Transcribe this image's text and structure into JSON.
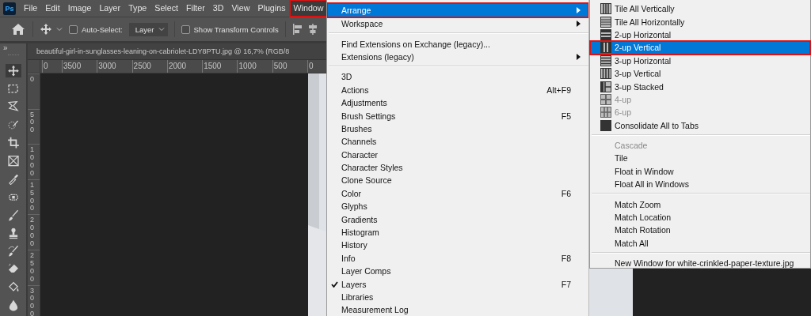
{
  "app_logo": "Ps",
  "menu_bar": [
    {
      "label": "File",
      "selected": false
    },
    {
      "label": "Edit",
      "selected": false
    },
    {
      "label": "Image",
      "selected": false
    },
    {
      "label": "Layer",
      "selected": false
    },
    {
      "label": "Type",
      "selected": false
    },
    {
      "label": "Select",
      "selected": false
    },
    {
      "label": "Filter",
      "selected": false
    },
    {
      "label": "3D",
      "selected": false
    },
    {
      "label": "View",
      "selected": false
    },
    {
      "label": "Plugins",
      "selected": false
    },
    {
      "label": "Window",
      "selected": true
    }
  ],
  "options_bar": {
    "auto_select": {
      "label": "Auto-Select:",
      "checked": false
    },
    "layer_dropdown": "Layer",
    "show_transform": {
      "label": "Show Transform Controls",
      "checked": false
    }
  },
  "toolbar_collapse": "»",
  "document_tab": "beautiful-girl-in-sunglasses-leaning-on-cabriolet-LDY8PTU.jpg @ 16,7% (RGB/8",
  "horizontal_ruler": [
    "0",
    "3500",
    "3000",
    "2500",
    "2000",
    "1500",
    "1000",
    "500",
    "0"
  ],
  "vertical_ruler": [
    "0",
    "500",
    "1000",
    "1500",
    "2000",
    "2500",
    "3000"
  ],
  "window_menu": [
    [
      {
        "label": "Arrange",
        "submenu": true,
        "selected": true,
        "checked": false
      },
      {
        "label": "Workspace",
        "submenu": true,
        "selected": false,
        "checked": false
      }
    ],
    [
      {
        "label": "Find Extensions on Exchange (legacy)...",
        "submenu": false,
        "selected": false,
        "checked": false
      },
      {
        "label": "Extensions (legacy)",
        "submenu": true,
        "selected": false,
        "checked": false
      }
    ],
    [
      {
        "label": "3D",
        "submenu": false,
        "selected": false,
        "checked": false
      },
      {
        "label": "Actions",
        "shortcut": "Alt+F9",
        "submenu": false,
        "selected": false,
        "checked": false
      },
      {
        "label": "Adjustments",
        "submenu": false,
        "selected": false,
        "checked": false
      },
      {
        "label": "Brush Settings",
        "shortcut": "F5",
        "submenu": false,
        "selected": false,
        "checked": false
      },
      {
        "label": "Brushes",
        "submenu": false,
        "selected": false,
        "checked": false
      },
      {
        "label": "Channels",
        "submenu": false,
        "selected": false,
        "checked": false
      },
      {
        "label": "Character",
        "submenu": false,
        "selected": false,
        "checked": false
      },
      {
        "label": "Character Styles",
        "submenu": false,
        "selected": false,
        "checked": false
      },
      {
        "label": "Clone Source",
        "submenu": false,
        "selected": false,
        "checked": false
      },
      {
        "label": "Color",
        "shortcut": "F6",
        "submenu": false,
        "selected": false,
        "checked": false
      },
      {
        "label": "Glyphs",
        "submenu": false,
        "selected": false,
        "checked": false
      },
      {
        "label": "Gradients",
        "submenu": false,
        "selected": false,
        "checked": false
      },
      {
        "label": "Histogram",
        "submenu": false,
        "selected": false,
        "checked": false
      },
      {
        "label": "History",
        "submenu": false,
        "selected": false,
        "checked": false
      },
      {
        "label": "Info",
        "shortcut": "F8",
        "submenu": false,
        "selected": false,
        "checked": false
      },
      {
        "label": "Layer Comps",
        "submenu": false,
        "selected": false,
        "checked": false
      },
      {
        "label": "Layers",
        "shortcut": "F7",
        "submenu": false,
        "selected": false,
        "checked": true
      },
      {
        "label": "Libraries",
        "submenu": false,
        "selected": false,
        "checked": false
      },
      {
        "label": "Measurement Log",
        "submenu": false,
        "selected": false,
        "checked": false
      }
    ]
  ],
  "arrange_submenu": [
    [
      {
        "label": "Tile All Vertically",
        "kind": "tile-vertical",
        "disabled": false,
        "selected": false
      },
      {
        "label": "Tile All Horizontally",
        "kind": "tile-horizontal",
        "disabled": false,
        "selected": false
      },
      {
        "label": "2-up Horizontal",
        "kind": "two-horizontal",
        "disabled": false,
        "selected": false
      },
      {
        "label": "2-up Vertical",
        "kind": "two-vertical",
        "disabled": false,
        "selected": true
      },
      {
        "label": "3-up Horizontal",
        "kind": "three-horizontal",
        "disabled": false,
        "selected": false
      },
      {
        "label": "3-up Vertical",
        "kind": "three-vertical",
        "disabled": false,
        "selected": false
      },
      {
        "label": "3-up Stacked",
        "kind": "three-stacked",
        "disabled": false,
        "selected": false
      },
      {
        "label": "4-up",
        "kind": "four",
        "disabled": true,
        "selected": false
      },
      {
        "label": "6-up",
        "kind": "six",
        "disabled": true,
        "selected": false
      },
      {
        "label": "Consolidate All to Tabs",
        "kind": "consolidate",
        "disabled": false,
        "selected": false
      }
    ],
    [
      {
        "label": "Cascade",
        "kind": "plain",
        "disabled": true,
        "selected": false
      },
      {
        "label": "Tile",
        "kind": "plain",
        "disabled": false,
        "selected": false
      },
      {
        "label": "Float in Window",
        "kind": "plain",
        "disabled": false,
        "selected": false
      },
      {
        "label": "Float All in Windows",
        "kind": "plain",
        "disabled": false,
        "selected": false
      }
    ],
    [
      {
        "label": "Match Zoom",
        "kind": "plain",
        "disabled": false,
        "selected": false
      },
      {
        "label": "Match Location",
        "kind": "plain",
        "disabled": false,
        "selected": false
      },
      {
        "label": "Match Rotation",
        "kind": "plain",
        "disabled": false,
        "selected": false
      },
      {
        "label": "Match All",
        "kind": "plain",
        "disabled": false,
        "selected": false
      }
    ],
    [
      {
        "label": "New Window for white-crinkled-paper-texture.jpg",
        "kind": "plain",
        "disabled": false,
        "selected": false
      }
    ]
  ]
}
